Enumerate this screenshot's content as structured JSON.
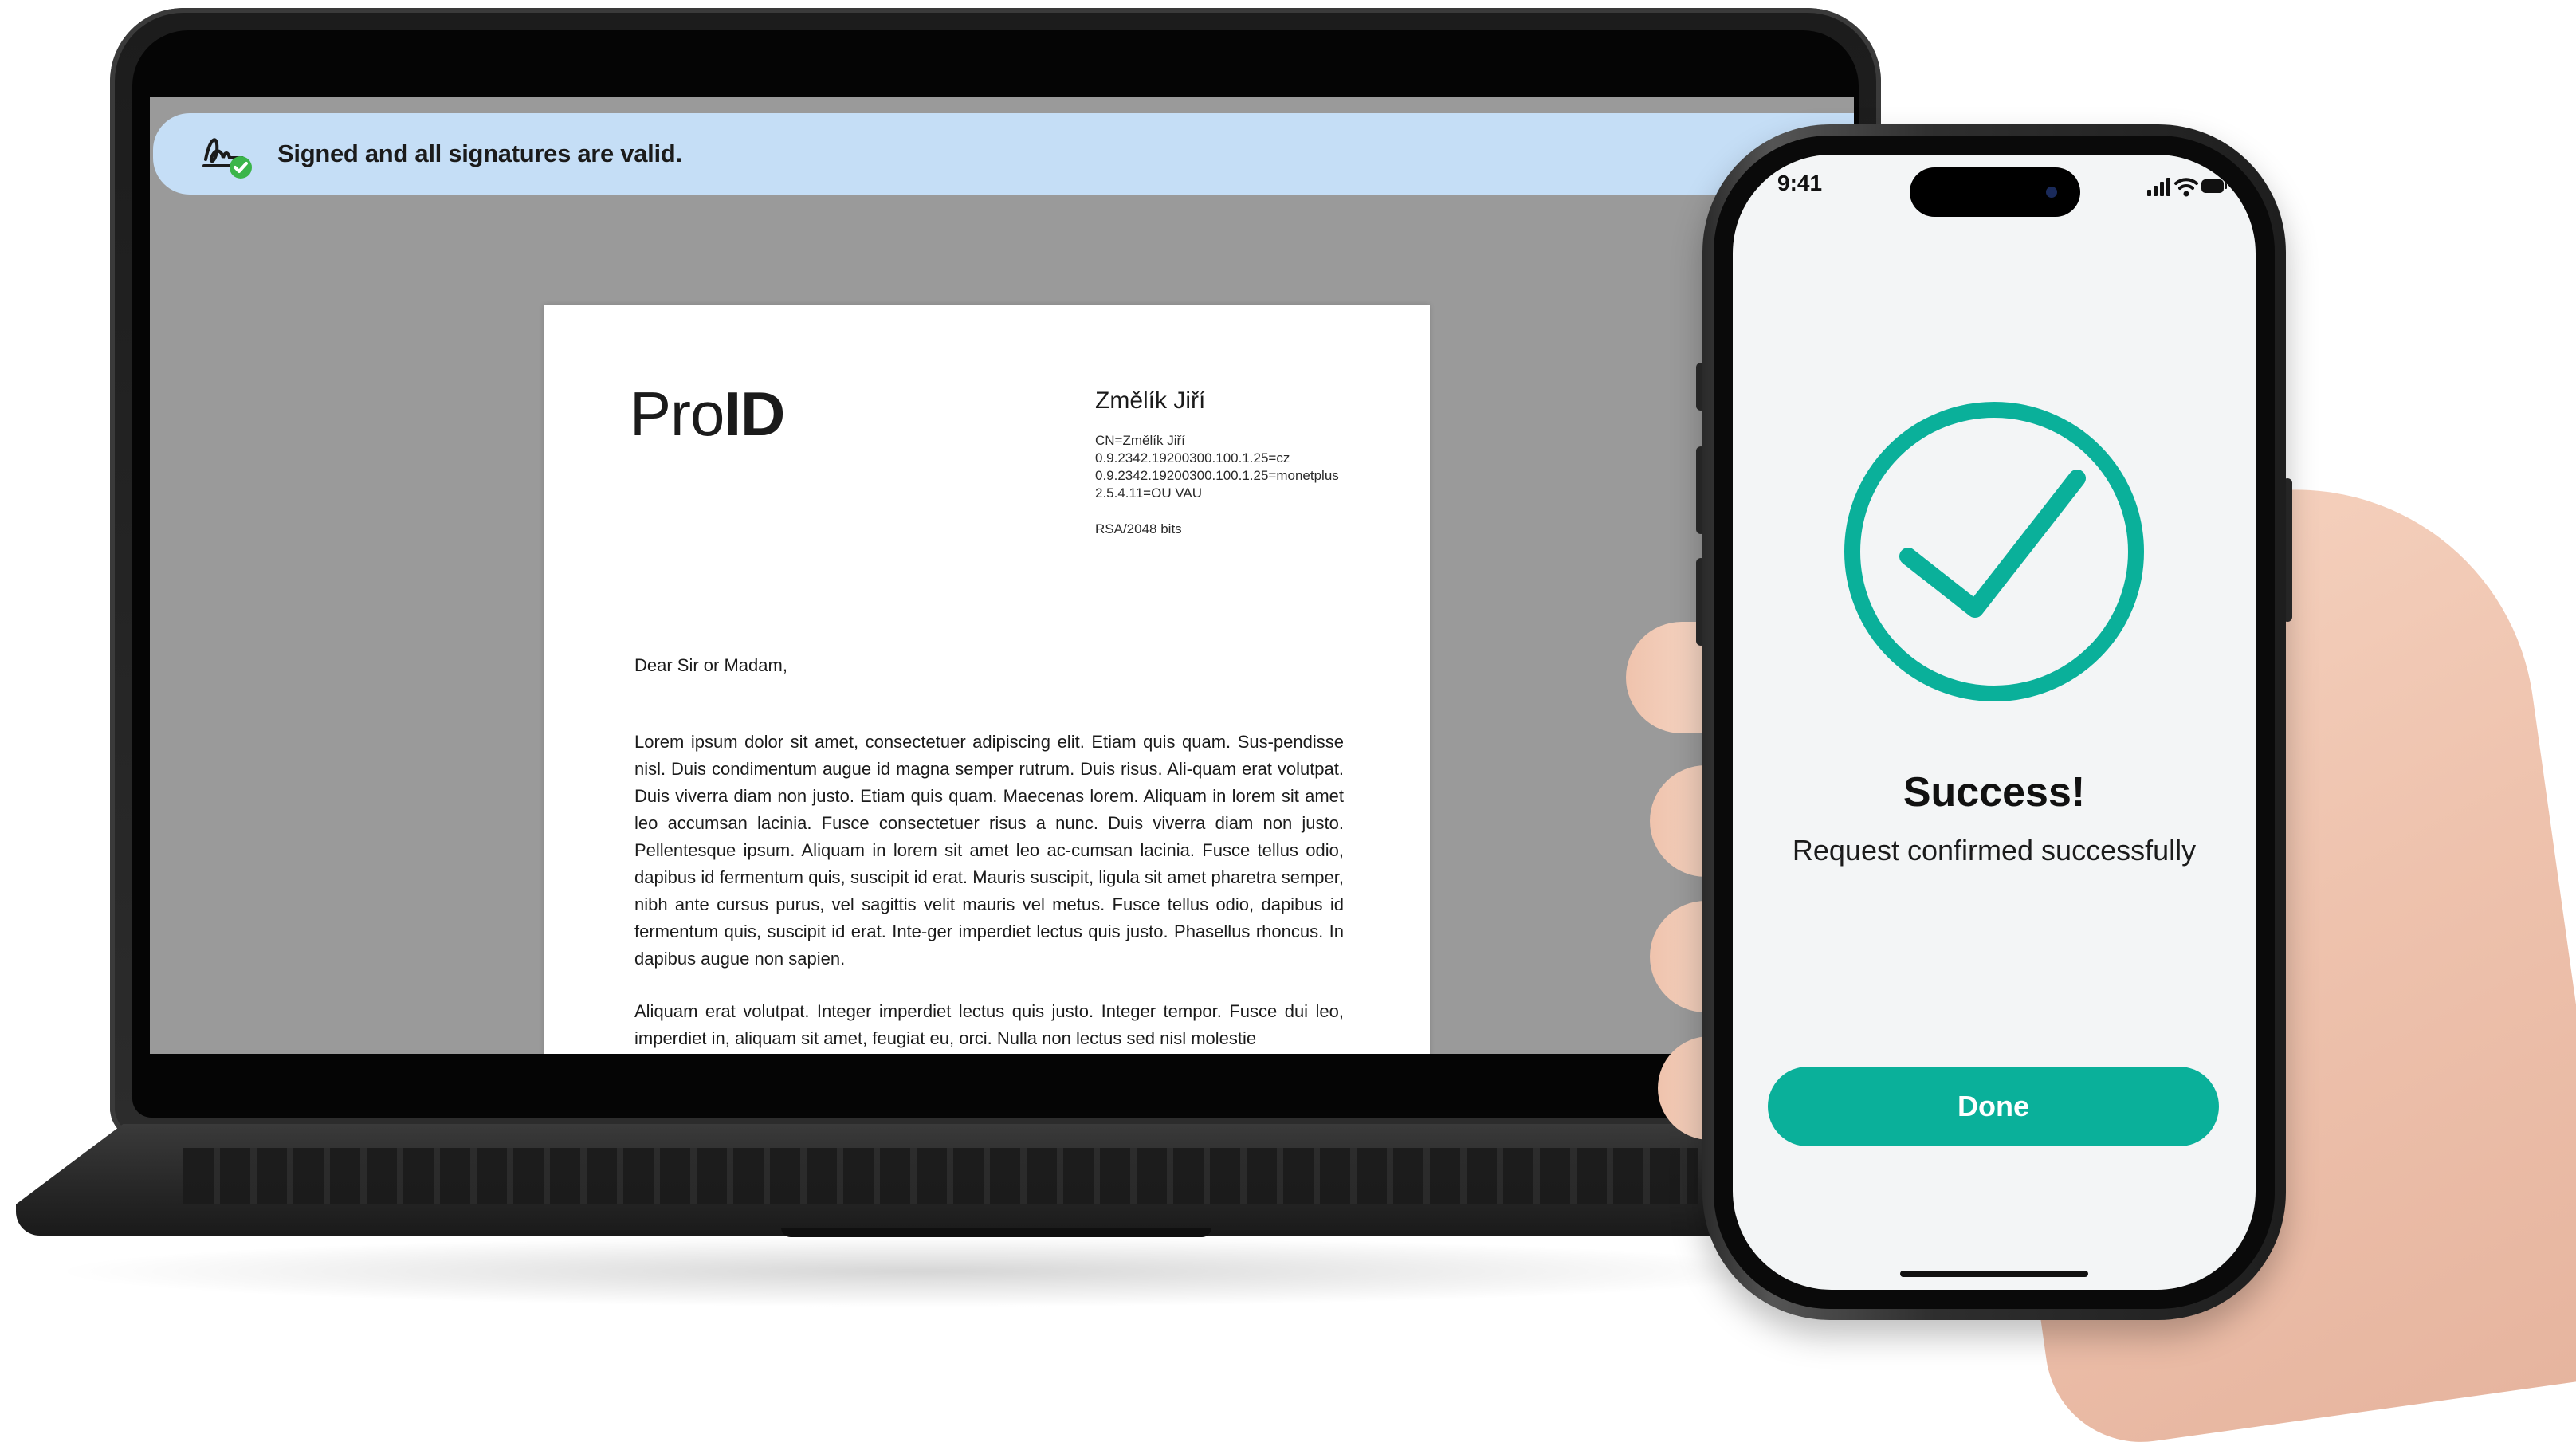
{
  "laptop": {
    "banner": {
      "icon": "signature-check-icon",
      "text": "Signed and all signatures are valid."
    },
    "document": {
      "logo_light": "Pro",
      "logo_bold": "ID",
      "signer_name": "Změlík Jiří",
      "cert_lines": [
        "CN=Změlík Jiří",
        "0.9.2342.19200300.100.1.25=cz",
        "0.9.2342.19200300.100.1.25=monetplus",
        "2.5.4.11=OU VAU"
      ],
      "key_info": "RSA/2048 bits",
      "salutation": "Dear Sir or Madam,",
      "paragraph1": "Lorem ipsum dolor sit amet, consectetuer adipiscing elit. Etiam quis quam. Sus-pendisse nisl. Duis condimentum augue id magna semper rutrum. Duis risus. Ali-quam erat volutpat. Duis viverra diam non justo. Etiam quis quam. Maecenas lorem. Aliquam in lorem sit amet leo accumsan lacinia. Fusce consectetuer risus a nunc. Duis viverra diam non justo. Pellentesque ipsum. Aliquam in lorem sit amet leo ac-cumsan lacinia. Fusce tellus odio, dapibus id fermentum quis, suscipit id erat. Mauris suscipit, ligula sit amet pharetra semper, nibh ante cursus purus, vel sagittis velit mauris vel metus. Fusce tellus odio, dapibus id fermentum quis, suscipit id erat. Inte-ger imperdiet lectus quis justo. Phasellus rhoncus. In dapibus augue non sapien.",
      "paragraph2": "Aliquam erat volutpat. Integer imperdiet lectus quis justo. Integer tempor. Fusce dui leo, imperdiet in, aliquam sit amet, feugiat eu, orci. Nulla non lectus sed nisl molestie"
    }
  },
  "phone": {
    "status_time": "9:41",
    "status_icons": [
      "cellular-signal-icon",
      "wifi-icon",
      "battery-icon"
    ],
    "success_icon": "check-circle-icon",
    "title": "Success!",
    "message": "Request confirmed successfully",
    "done_label": "Done",
    "accent_color": "#0ab09a"
  }
}
